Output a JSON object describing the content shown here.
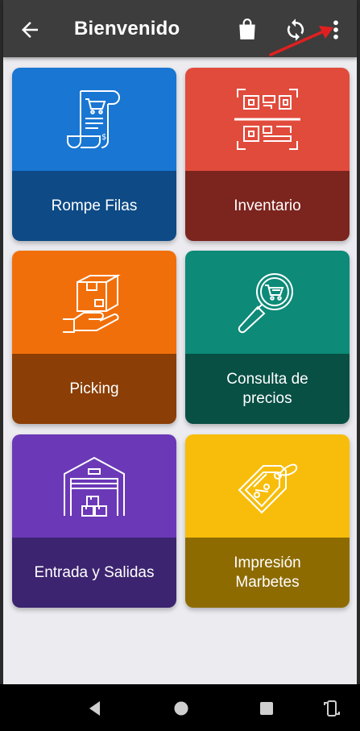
{
  "header": {
    "title": "Bienvenido"
  },
  "tiles": [
    {
      "label": "Rompe Filas",
      "icon": "receipt-cart-icon",
      "top_color": "#1976d2",
      "bottom_color": "#0d4a86"
    },
    {
      "label": "Inventario",
      "icon": "qr-code-icon",
      "top_color": "#e14b3c",
      "bottom_color": "#7c241e"
    },
    {
      "label": "Picking",
      "icon": "hand-box-icon",
      "top_color": "#f16f0b",
      "bottom_color": "#8b3e05"
    },
    {
      "label": "Consulta de\nprecios",
      "icon": "magnifier-cart-icon",
      "top_color": "#0d8a78",
      "bottom_color": "#084f44"
    },
    {
      "label": "Entrada y Salidas",
      "icon": "warehouse-icon",
      "top_color": "#6b39b7",
      "bottom_color": "#3c2470"
    },
    {
      "label": "Impresión\nMarbetes",
      "icon": "price-tag-icon",
      "top_color": "#f8bd0a",
      "bottom_color": "#8d6b00"
    }
  ],
  "colors": {
    "appbar": "#3d3d3d",
    "background": "#ececf0",
    "annotation_arrow": "#e02020"
  }
}
